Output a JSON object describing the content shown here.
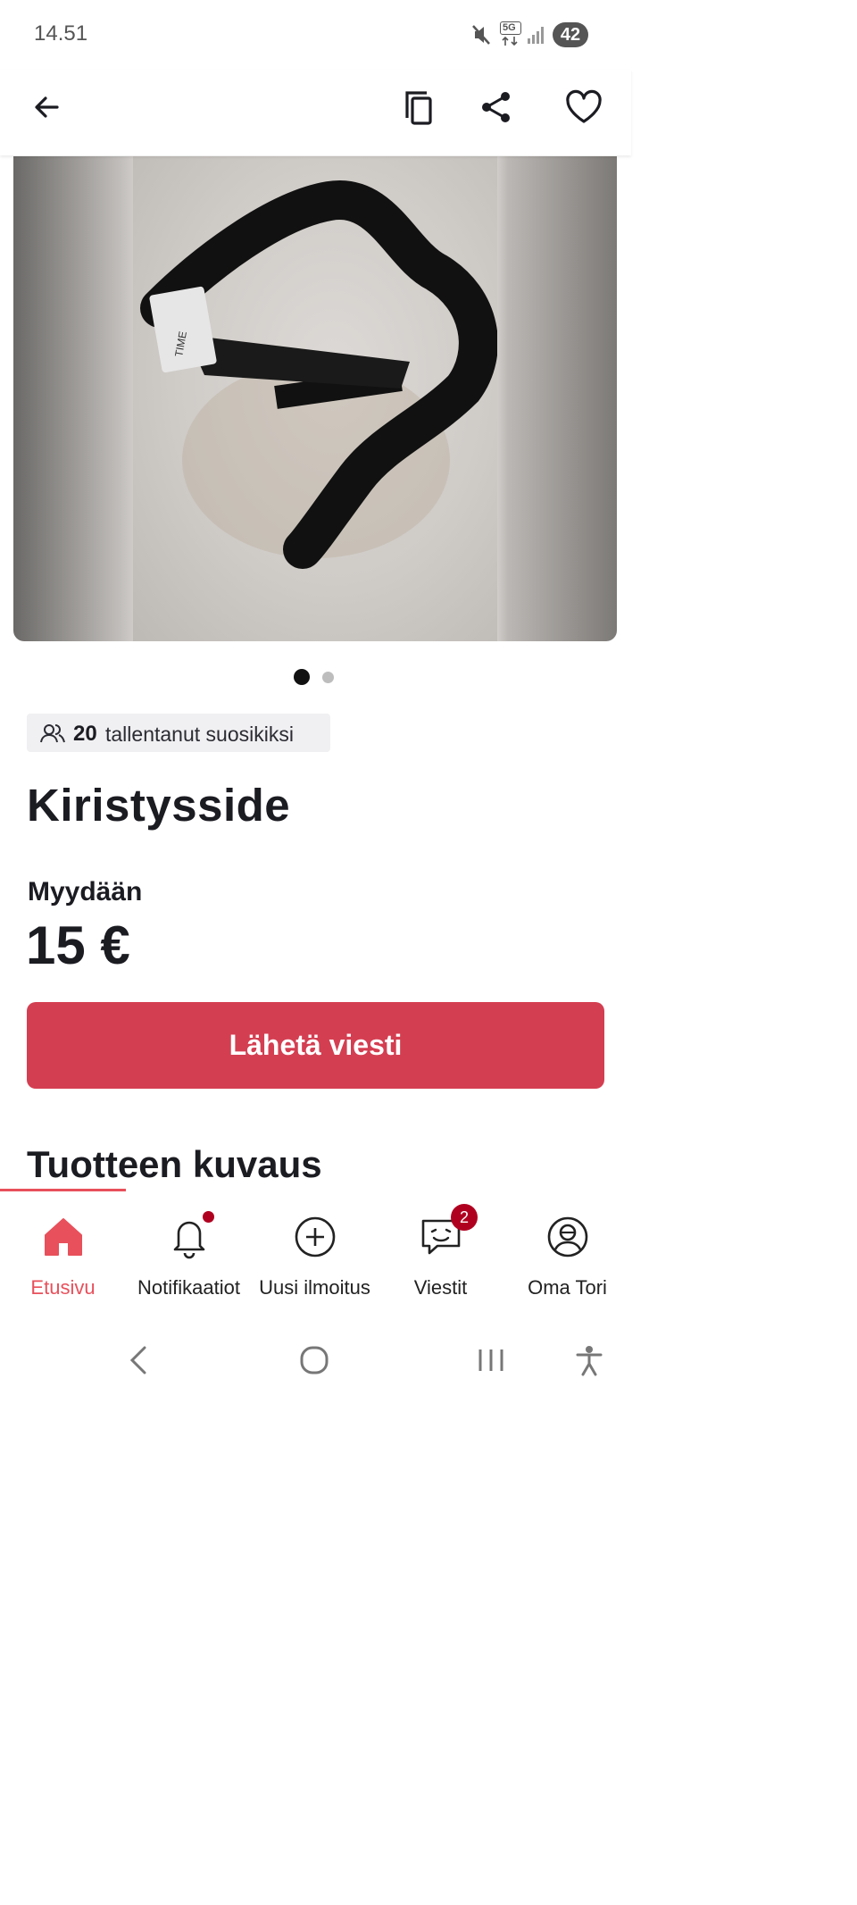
{
  "status_bar": {
    "time": "14.51",
    "network_label": "5G",
    "battery": "42",
    "icons": [
      "mute-icon",
      "network-5g-icon",
      "signal-icon",
      "battery-icon"
    ]
  },
  "app_bar": {
    "icons": [
      "back-arrow-icon",
      "copy-icon",
      "share-icon",
      "heart-icon"
    ]
  },
  "listing": {
    "image_count": 2,
    "current_image": 1,
    "favorites_count": "20",
    "favorites_text": "tallentanut suosikiksi",
    "title": "Kiristysside",
    "trade_type": "Myydään",
    "price": "15 €",
    "send_button_label": "Lähetä viesti",
    "description_heading": "Tuotteen kuvaus"
  },
  "bottom_nav": {
    "items": [
      {
        "label": "Etusivu",
        "icon": "home-icon",
        "active": true
      },
      {
        "label": "Notifikaatiot",
        "icon": "bell-icon",
        "has_dot": true
      },
      {
        "label": "Uusi ilmoitus",
        "icon": "plus-circle-icon"
      },
      {
        "label": "Viestit",
        "icon": "chat-icon",
        "badge": "2"
      },
      {
        "label": "Oma Tori",
        "icon": "profile-icon"
      }
    ]
  },
  "system_nav": {
    "icons": [
      "back-chevron-icon",
      "home-circle-icon",
      "recents-icon",
      "accessibility-icon"
    ]
  },
  "colors": {
    "accent": "#d43e51",
    "active_nav": "#e8505b",
    "badge": "#b00020",
    "text": "#1b1b22"
  }
}
